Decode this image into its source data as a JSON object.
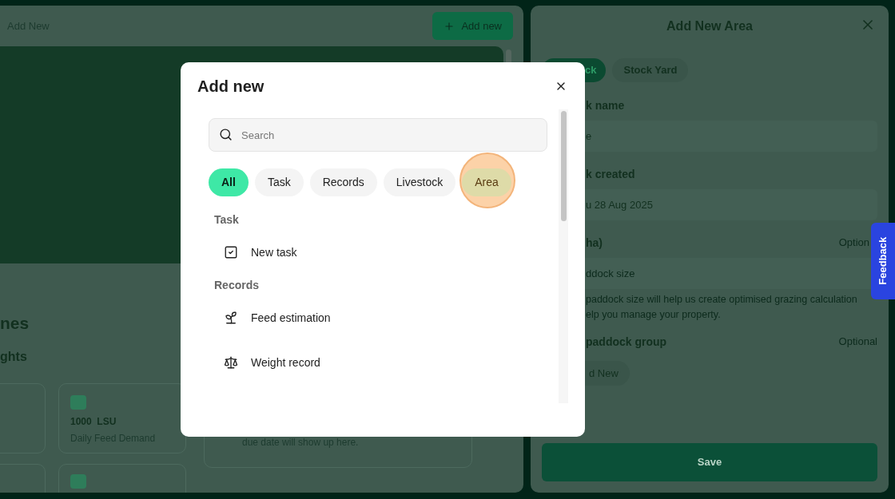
{
  "main": {
    "header_label": "Add New",
    "add_button": "Add new",
    "heading": "nes",
    "subheading": "ghts",
    "stat_card": {
      "value": "1000",
      "unit": "LSU",
      "label": "Daily Feed Demand"
    },
    "tasks_card": {
      "text": "due date will show up here."
    }
  },
  "side_panel": {
    "title": "Add New Area",
    "tabs": [
      {
        "label": "ck",
        "selected": true
      },
      {
        "label": "Stock Yard",
        "selected": false
      }
    ],
    "name_label": "k name",
    "name_value": "e",
    "created_label": "k created",
    "created_value": "u 28 Aug 2025",
    "size_label": "ha)",
    "size_optional": "Option",
    "size_placeholder": "ddock size",
    "size_help": [
      "paddock size will help us create optimised grazing calculation",
      "elp you manage your property."
    ],
    "group_label": "paddock group",
    "group_optional": "Optional",
    "group_button": "d New",
    "save_button": "Save"
  },
  "feedback_tab": "Feedback",
  "modal": {
    "title": "Add new",
    "search": {
      "placeholder": "Search"
    },
    "filters": [
      {
        "label": "All",
        "selected": true,
        "highlighted": false
      },
      {
        "label": "Task",
        "selected": false,
        "highlighted": false
      },
      {
        "label": "Records",
        "selected": false,
        "highlighted": false
      },
      {
        "label": "Livestock",
        "selected": false,
        "highlighted": false
      },
      {
        "label": "Area",
        "selected": false,
        "highlighted": true
      }
    ],
    "sections": [
      {
        "title": "Task",
        "items": [
          {
            "label": "New task",
            "kind": "task"
          }
        ]
      },
      {
        "title": "Records",
        "items": [
          {
            "label": "Feed estimation",
            "kind": "feed"
          },
          {
            "label": "Weight record",
            "kind": "weight"
          }
        ]
      }
    ]
  }
}
